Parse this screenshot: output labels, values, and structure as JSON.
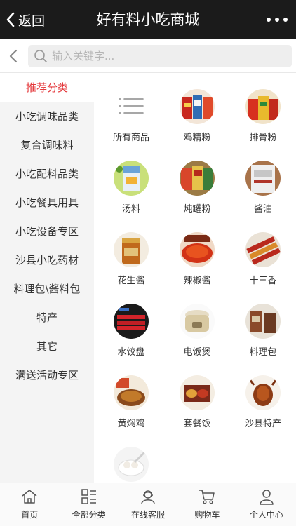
{
  "header": {
    "back_label": "返回",
    "title": "好有料小吃商城"
  },
  "search": {
    "placeholder": "输入关键字..."
  },
  "sidebar": {
    "items": [
      {
        "label": "推荐分类",
        "active": true
      },
      {
        "label": "小吃调味品类"
      },
      {
        "label": "复合调味料"
      },
      {
        "label": "小吃配料品类"
      },
      {
        "label": "小吃餐具用具"
      },
      {
        "label": "小吃设备专区"
      },
      {
        "label": "沙县小吃药材"
      },
      {
        "label": "料理包\\酱料包"
      },
      {
        "label": "特产"
      },
      {
        "label": "其它"
      },
      {
        "label": "满送活动专区"
      }
    ]
  },
  "categories": [
    {
      "label": "所有商品",
      "icon": "list-icon"
    },
    {
      "label": "鸡精粉",
      "icon": "chicken-powder-image"
    },
    {
      "label": "排骨粉",
      "icon": "rib-powder-image"
    },
    {
      "label": "汤料",
      "icon": "soup-base-image"
    },
    {
      "label": "炖罐粉",
      "icon": "stew-powder-image"
    },
    {
      "label": "酱油",
      "icon": "soy-sauce-image"
    },
    {
      "label": "花生酱",
      "icon": "peanut-sauce-image"
    },
    {
      "label": "辣椒酱",
      "icon": "chili-sauce-image"
    },
    {
      "label": "十三香",
      "icon": "thirteen-spice-image"
    },
    {
      "label": "水饺盘",
      "icon": "dumpling-tray-image"
    },
    {
      "label": "电饭煲",
      "icon": "rice-cooker-image"
    },
    {
      "label": "料理包",
      "icon": "meal-pack-image"
    },
    {
      "label": "黄焖鸡",
      "icon": "braised-chicken-image"
    },
    {
      "label": "套餐饭",
      "icon": "set-meal-image"
    },
    {
      "label": "沙县特产",
      "icon": "shaxian-specialty-image"
    },
    {
      "label": "",
      "icon": "dessert-bowl-image"
    }
  ],
  "tabbar": {
    "items": [
      {
        "label": "首页",
        "icon": "home-icon"
      },
      {
        "label": "全部分类",
        "icon": "category-icon"
      },
      {
        "label": "在线客服",
        "icon": "customer-service-icon"
      },
      {
        "label": "购物车",
        "icon": "cart-icon"
      },
      {
        "label": "个人中心",
        "icon": "user-icon"
      }
    ]
  },
  "colors": {
    "header_bg": "#1b1b1b",
    "active": "#e4393c",
    "sidebar_bg": "#f4f4f4"
  }
}
